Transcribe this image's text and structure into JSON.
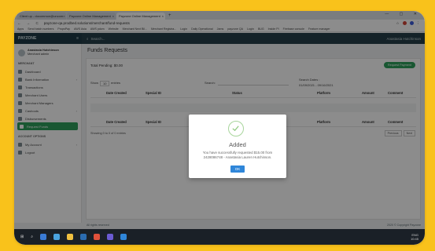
{
  "browser": {
    "tabs": [
      {
        "label": "Client up - docommon@uncom",
        "active": false
      },
      {
        "label": "Payzone Online Management",
        "active": false
      },
      {
        "label": "Payzone Online Management",
        "active": true
      }
    ],
    "new_tab": "+",
    "window_controls": "— ▢ ✕",
    "nav_buttons": "← → C",
    "url": "payzone-qa.prodbed.solutions/merchant/fund-requests",
    "bookmarks": [
      "Apps",
      "Send batch numbers",
      "PropsPay",
      "AWS Asia",
      "AWS pdcm",
      "Website",
      "Merchant Next Bil...",
      "Merchant Registra...",
      "Login",
      "Daily Operational",
      "Jams",
      "payzone QA",
      "Login",
      "BUG",
      "Inside PI",
      "Firebase console",
      "Feature manager"
    ]
  },
  "app": {
    "brand": "PAYZONE",
    "menu_icon": "≡",
    "search_placeholder": "Search...",
    "user_label": "Anastasia Hutchinson"
  },
  "sidebar": {
    "profile_name": "Anastasia Hutchinson",
    "profile_role": "Merchant admin",
    "section_merchant": "MERCHANT",
    "items": [
      {
        "label": "Dashboard",
        "icon": "dashboard-icon",
        "chevron": ""
      },
      {
        "label": "Bank Information",
        "icon": "bank-icon",
        "chevron": "›"
      },
      {
        "label": "Transactions",
        "icon": "transactions-icon",
        "chevron": ""
      },
      {
        "label": "Merchant Users",
        "icon": "users-icon",
        "chevron": ""
      },
      {
        "label": "Merchant Managers",
        "icon": "managers-icon",
        "chevron": ""
      },
      {
        "label": "Cashouts",
        "icon": "cashout-icon",
        "chevron": "›"
      },
      {
        "label": "Disbursements",
        "icon": "disbursement-icon",
        "chevron": ""
      },
      {
        "label": "Request Funds",
        "icon": "funds-icon",
        "chevron": "",
        "active": true
      }
    ],
    "section_account": "ACCOUNT OPTIONS",
    "account_items": [
      {
        "label": "My Account",
        "icon": "account-icon",
        "chevron": "›"
      },
      {
        "label": "Logout",
        "icon": "logout-icon",
        "chevron": ""
      }
    ]
  },
  "main": {
    "title": "Funds Requests",
    "total": "Total Pending: $0.00",
    "request_button": "Request Payment",
    "show_label": "Show",
    "show_value": "10",
    "entries_label": "entries",
    "search_label": "Search:",
    "search_dates_label": "Search Dates :",
    "date_range": "01/09/2021 - 09/16/2021",
    "columns": [
      "Date Created",
      "Special ID",
      "Status",
      "Platform",
      "Amount",
      "Comment"
    ],
    "showing_text": "Showing 0 to 0 of 0 entries",
    "pager_prev": "Previous",
    "pager_next": "Next"
  },
  "footer": {
    "left": "All rights reserved",
    "right": "2020 © Copyright Payzone"
  },
  "modal": {
    "title": "Added",
    "message": "You have successfully requested $15.00 from 2428086748 - Anastasia Lauren Hutchinson.",
    "ok_label": "OK",
    "icon": "success-check-icon"
  },
  "taskbar": {
    "search_glyph": "⌕",
    "tray_text": "ENG",
    "tray_time": "10:45"
  },
  "colors": {
    "background": "#f9c21b",
    "accent_green": "#2e9e5b",
    "header_dark": "#1e3a45",
    "ok_blue": "#2f86d9"
  }
}
